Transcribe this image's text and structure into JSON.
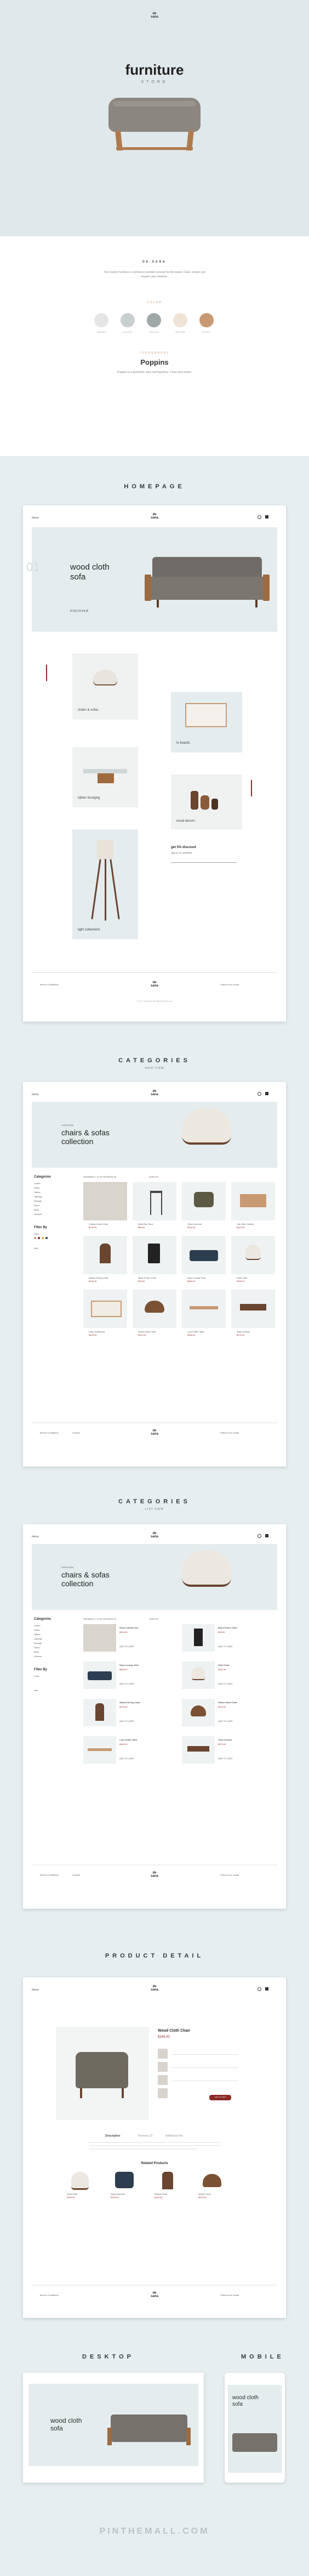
{
  "brand": {
    "logo_line1": "de",
    "logo_line2": "sana"
  },
  "hero": {
    "title": "furniture",
    "subtitle": "STORE"
  },
  "style": {
    "heading": "DE.SANA",
    "intro": "The modern furniture e-commerce website concept for the brand. Clean, simple and elegant user interface.",
    "colors_label": "COLOR",
    "colors": [
      {
        "hex": "#e5e5e5",
        "name": "#E5E5E5"
      },
      {
        "hex": "#c9ced1",
        "name": "#C9CED1"
      },
      {
        "hex": "#9fa7a8",
        "name": "#9FA7A8"
      },
      {
        "hex": "#efe3d6",
        "name": "#EFE3D6"
      },
      {
        "hex": "#c79a74",
        "name": "#C79A74"
      }
    ],
    "typography_label": "TYPOGRAPHY",
    "font_name": "Poppins",
    "font_desc": "Poppins is a geometric sans serif typeface. Clean and simple."
  },
  "sections": {
    "homepage": "HOMEPAGE",
    "categories1": "CATEGORIES",
    "categories1_sub": "GRID VIEW",
    "categories2": "CATEGORIES",
    "categories2_sub": "LIST VIEW",
    "product": "PRODUCT DETAIL",
    "desktop": "DESKTOP",
    "mobile": "MOBILE"
  },
  "nav": {
    "menu": "menu",
    "search_icon": "search-icon",
    "cart_icon": "cart-icon"
  },
  "homepage": {
    "hero_num": "01",
    "hero_title_line1": "wood cloth",
    "hero_title_line2": "sofa",
    "hero_link": "DISCOVER",
    "tiles": [
      {
        "label": "chairs & sofas"
      },
      {
        "label": "tv boards"
      },
      {
        "label": "tables lounging"
      },
      {
        "label": "wood decors"
      },
      {
        "label": "light collections"
      }
    ],
    "discount_title": "get 5% discount",
    "discount_text": "Sign up for newsletter"
  },
  "footer": {
    "left": "Terms & Conditions",
    "left2": "Contact",
    "right": "Follow us on social",
    "copyright": "© 2017 Desana. All Rights Reserved."
  },
  "categories": {
    "hero_small": "SHOP NOW",
    "hero_line1": "chairs & sofas",
    "hero_line2": "collection",
    "sidebar_title": "Categories",
    "sidebar_items": [
      "Chairs",
      "Sofas",
      "Tables",
      "Lighting",
      "Storage",
      "Decor",
      "Beds",
      "Outdoor"
    ],
    "filter_title": "Filter By",
    "filter_color": "Color",
    "filter_size": "Size",
    "toolbar_show": "SHOWING 1-12 OF 60 RESULTS",
    "toolbar_sort": "SORT BY",
    "grid_products": [
      {
        "name": "Classic Wood Chair",
        "price": "$120.00"
      },
      {
        "name": "Metal Bar Stool",
        "price": "$85.00"
      },
      {
        "name": "Olive Armchair",
        "price": "$249.00"
      },
      {
        "name": "Oak Side Cabinet",
        "price": "$310.00"
      },
      {
        "name": "Walnut Dining Chair",
        "price": "$140.00"
      },
      {
        "name": "Black Frame Chair",
        "price": "$99.00"
      },
      {
        "name": "Navy Lounge Sofa",
        "price": "$899.00"
      },
      {
        "name": "Shell Chair",
        "price": "$180.00"
      },
      {
        "name": "Retro Sideboard",
        "price": "$420.00"
      },
      {
        "name": "Wicker Bowl Chair",
        "price": "$210.00"
      },
      {
        "name": "Low Coffee Table",
        "price": "$160.00"
      },
      {
        "name": "Teak Console",
        "price": "$275.00"
      }
    ],
    "list_products": [
      {
        "name": "Wood Cabinet Set",
        "price": "$310.00"
      },
      {
        "name": "Black Frame Chair",
        "price": "$99.00"
      },
      {
        "name": "Navy Lounge Sofa",
        "price": "$899.00"
      },
      {
        "name": "Shell Chair",
        "price": "$180.00"
      },
      {
        "name": "Walnut Dining Chair",
        "price": "$140.00"
      },
      {
        "name": "Wicker Bowl Chair",
        "price": "$210.00"
      },
      {
        "name": "Low Coffee Table",
        "price": "$160.00"
      },
      {
        "name": "Teak Console",
        "price": "$275.00"
      }
    ],
    "add_to_cart": "ADD TO CART"
  },
  "product": {
    "name": "Wood Cloth Chair",
    "price": "$249.00",
    "add_label": "ADD TO CART",
    "tabs": [
      "Description",
      "Reviews (2)",
      "Additional Info"
    ],
    "related_title": "Related Products",
    "related": [
      {
        "name": "Shell Chair",
        "price": "$180.00"
      },
      {
        "name": "Navy Armchair",
        "price": "$320.00"
      },
      {
        "name": "Walnut Chair",
        "price": "$140.00"
      },
      {
        "name": "Wicker Chair",
        "price": "$210.00"
      }
    ]
  },
  "showcase": {
    "desktop_title_line1": "wood cloth",
    "desktop_title_line2": "sofa",
    "mobile_title_line1": "wood cloth",
    "mobile_title_line2": "sofa"
  },
  "watermark": "PINTHEMALL.COM"
}
